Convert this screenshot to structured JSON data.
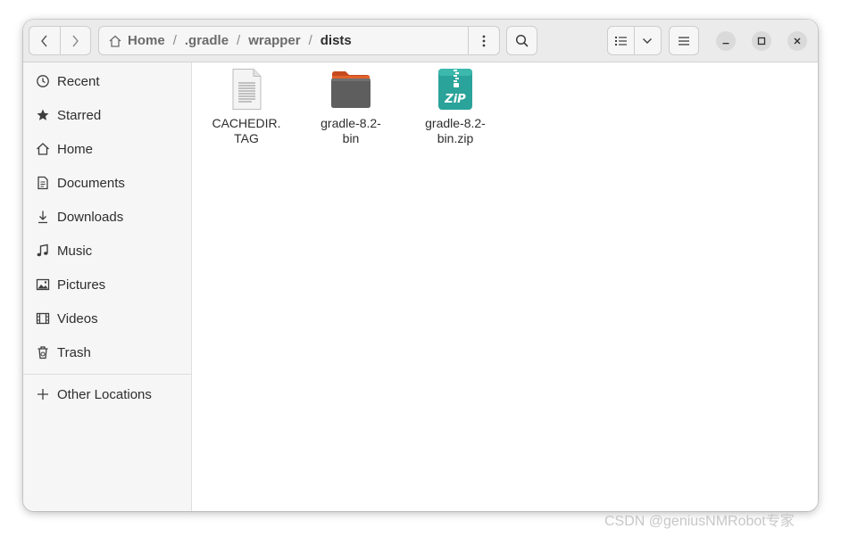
{
  "path": {
    "home": "Home",
    "segments": [
      ".gradle",
      "wrapper"
    ],
    "current": "dists",
    "separator": "/"
  },
  "sidebar": {
    "items": [
      {
        "label": "Recent",
        "icon": "clock-icon"
      },
      {
        "label": "Starred",
        "icon": "star-icon"
      },
      {
        "label": "Home",
        "icon": "home-icon"
      },
      {
        "label": "Documents",
        "icon": "document-icon"
      },
      {
        "label": "Downloads",
        "icon": "download-icon"
      },
      {
        "label": "Music",
        "icon": "music-note-icon"
      },
      {
        "label": "Pictures",
        "icon": "image-icon"
      },
      {
        "label": "Videos",
        "icon": "film-icon"
      },
      {
        "label": "Trash",
        "icon": "trash-icon"
      }
    ],
    "other": {
      "label": "Other Locations",
      "icon": "plus-icon"
    }
  },
  "files": [
    {
      "name": "CACHEDIR.\nTAG",
      "type": "text-file"
    },
    {
      "name": "gradle-8.2-\nbin",
      "type": "folder"
    },
    {
      "name": "gradle-8.2-\nbin.zip",
      "type": "zip-archive"
    }
  ],
  "watermark": "CSDN @geniusNMRobot专家",
  "colors": {
    "folder_body": "#5e5e5e",
    "folder_tab": "#e0622a",
    "zip": "#2aa39a"
  }
}
